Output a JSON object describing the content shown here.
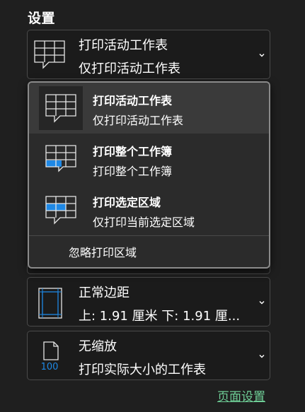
{
  "settings": {
    "title": "设置"
  },
  "print_what": {
    "title": "打印活动工作表",
    "description": "仅打印活动工作表",
    "icon": "sheet-grid-icon"
  },
  "menu": {
    "items": [
      {
        "title": "打印活动工作表",
        "description": "仅打印活动工作表",
        "icon": "active-sheet-icon",
        "selected": true
      },
      {
        "title": "打印整个工作簿",
        "description": "打印整个工作簿",
        "icon": "workbook-icon",
        "selected": false
      },
      {
        "title": "打印选定区域",
        "description": "仅打印当前选定区域",
        "icon": "selection-icon",
        "selected": false
      }
    ],
    "ignore_print_area": "忽略打印区域"
  },
  "margins": {
    "title": "正常边距",
    "description": "上: 1.91 厘米 下: 1.91 厘...",
    "icon": "margins-icon"
  },
  "scaling": {
    "title": "无缩放",
    "description": "打印实际大小的工作表",
    "icon": "no-scaling-page-icon",
    "icon_label": "100"
  },
  "page_setup_link": "页面设置",
  "colors": {
    "background": "#1f1f1f",
    "accent_blue": "#1e88e5",
    "link_green": "#6fcf97"
  }
}
